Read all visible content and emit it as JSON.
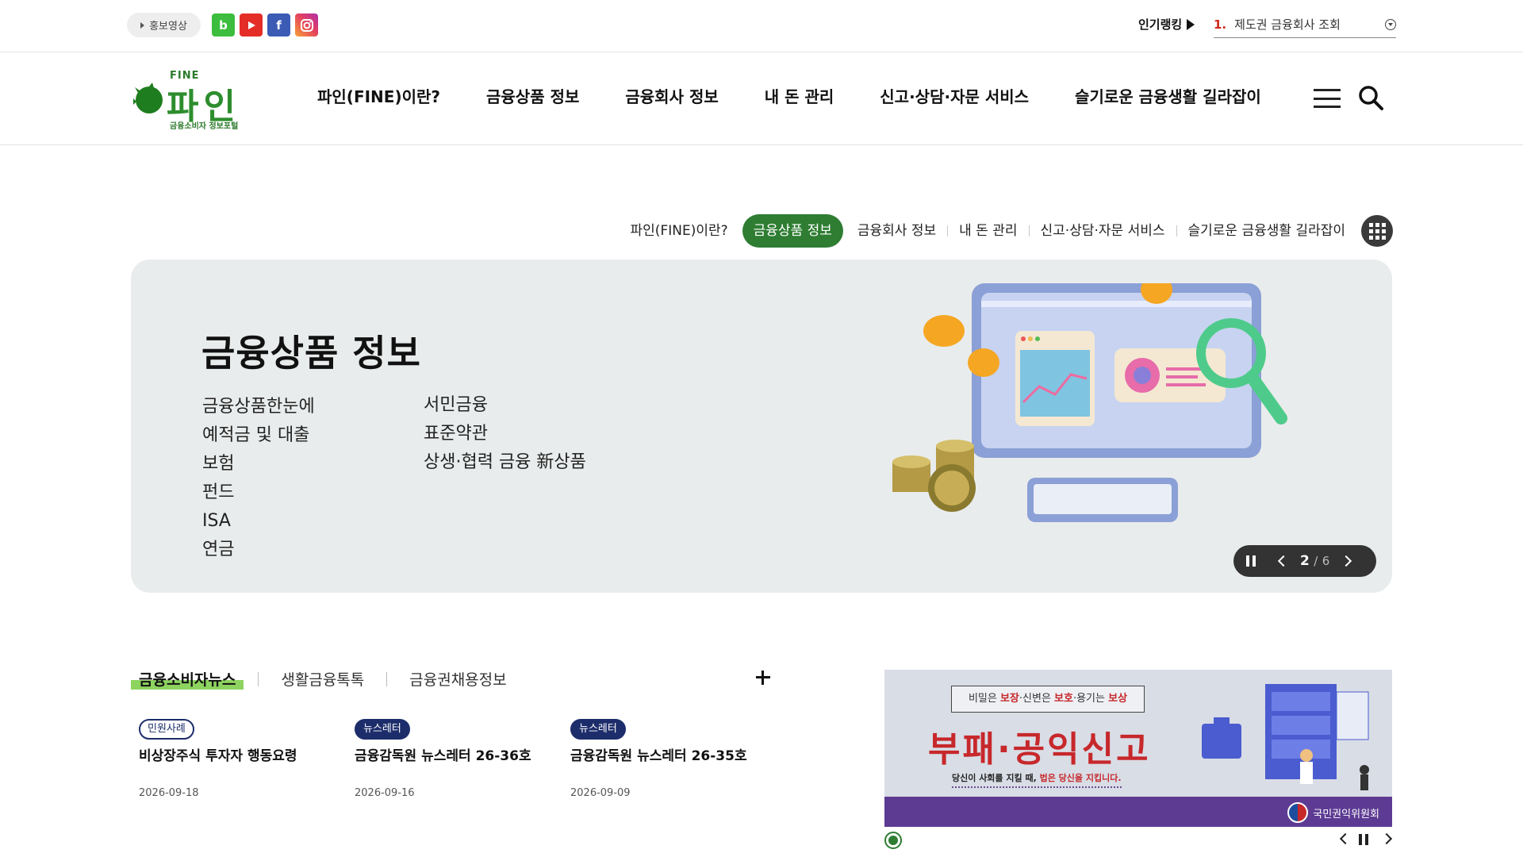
{
  "topbar": {
    "promo_label": "홍보영상",
    "sns": [
      {
        "name": "blog",
        "glyph": "b",
        "color": "#3dbd3d"
      },
      {
        "name": "youtube",
        "glyph": "▶",
        "color": "#e52d27"
      },
      {
        "name": "facebook",
        "glyph": "f",
        "color": "#3b5bb5"
      },
      {
        "name": "instagram",
        "glyph": "◎",
        "color": "#e4405f"
      }
    ],
    "ranking_label": "인기랭킹",
    "ranking_num": "1.",
    "ranking_text": "제도권 금융회사 조회"
  },
  "header": {
    "logo_fine": "FINE",
    "logo_name": "파인",
    "logo_sub": "금융소비자 정보포털",
    "nav": [
      "파인(FINE)이란?",
      "금융상품 정보",
      "금융회사 정보",
      "내 돈 관리",
      "신고·상담·자문 서비스",
      "슬기로운 금융생활 길라잡이"
    ]
  },
  "subtabs": {
    "items": [
      "파인(FINE)이란?",
      "금융상품 정보",
      "금융회사 정보",
      "내 돈 관리",
      "신고·상담·자문 서비스",
      "슬기로운 금융생활 길라잡이"
    ],
    "active_index": 1
  },
  "hero": {
    "title": "금융상품 정보",
    "col1": [
      "금융상품한눈에",
      "예적금 및 대출",
      "보험",
      "펀드",
      "ISA",
      "연금"
    ],
    "col2": [
      "서민금융",
      "표준약관",
      "상생·협력 금융 新상품"
    ],
    "slide_current": "2",
    "slide_sep": "/",
    "slide_total": "6"
  },
  "news": {
    "tabs": [
      "금융소비자뉴스",
      "생활금융톡톡",
      "금융권채용정보"
    ],
    "active_index": 0,
    "items": [
      {
        "badge": "민원사례",
        "badge_style": "outline",
        "title": "비상장주식 투자자 행동요령",
        "date": "2026-09-18"
      },
      {
        "badge": "뉴스레터",
        "badge_style": "filled",
        "title": "금융감독원 뉴스레터 26-36호",
        "date": "2026-09-16"
      },
      {
        "badge": "뉴스레터",
        "badge_style": "filled",
        "title": "금융감독원 뉴스레터 26-35호",
        "date": "2026-09-09"
      }
    ]
  },
  "side_banner": {
    "quote_pre": "비밀은 ",
    "quote_hl1": "보장",
    "quote_mid": "·신변은 ",
    "quote_hl2": "보호",
    "quote_mid2": "·용기는 ",
    "quote_hl3": "보상",
    "main": "부패·공익신고",
    "sub_pre": "당신이 사회를 지킬 때, ",
    "sub_hl": "법은 당신을 지킵니다.",
    "org": "국민권익위원회"
  },
  "colors": {
    "brand_green": "#2e7d32",
    "navy": "#1d2d6b",
    "alert_red": "#c7282b",
    "banner_purple": "#5d3b93"
  }
}
